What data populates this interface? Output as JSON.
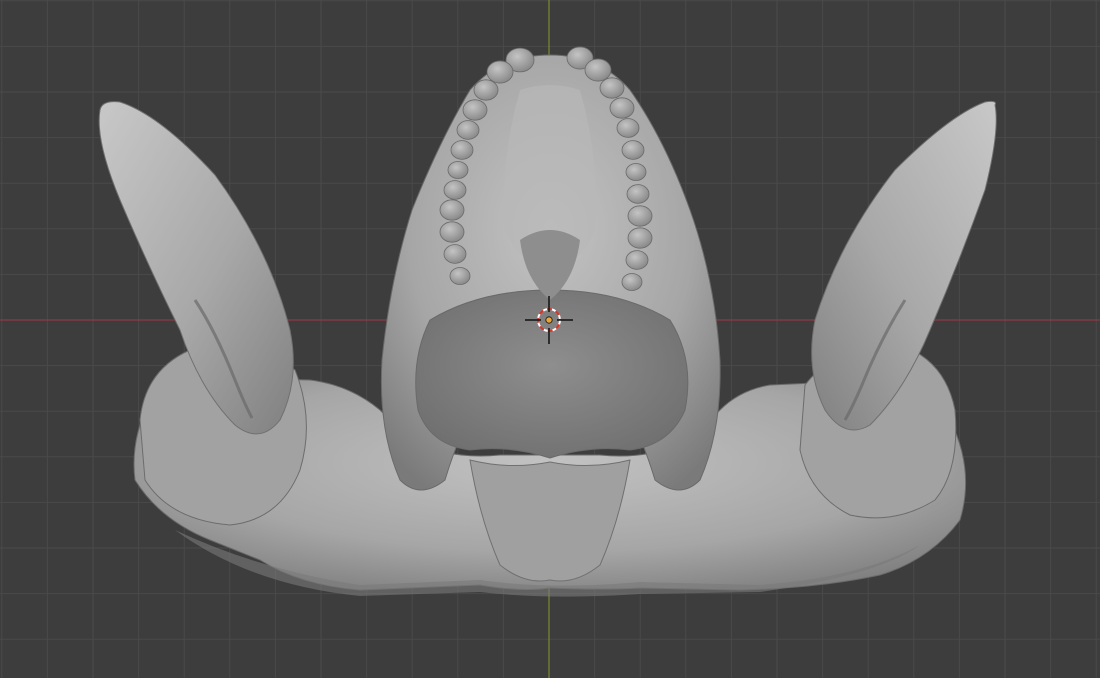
{
  "viewport": {
    "background_color": "#3d3d3d",
    "grid_color": "#4a4a4a",
    "x_axis_color": "#8c3b45",
    "y_axis_color": "#7d8a2c",
    "model_color": "#a4a4a4",
    "model_shadow_color": "#6e6e6e",
    "model_highlight_color": "#c6c6c6",
    "cursor_icon": "3d-cursor-icon",
    "origin_icon": "object-origin-icon",
    "origin_color": "#e8a33a"
  }
}
